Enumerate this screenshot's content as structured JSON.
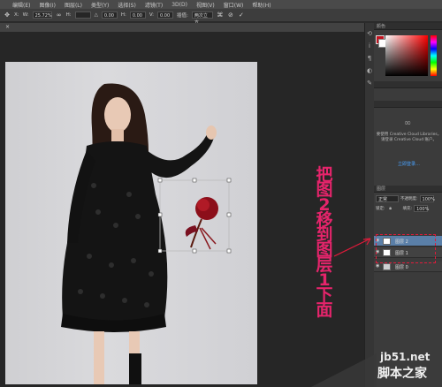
{
  "menubar": {
    "items": [
      "编辑(E)",
      "图像(I)",
      "图层(L)",
      "类型(Y)",
      "选择(S)",
      "滤镜(T)",
      "3D(D)",
      "视图(V)",
      "窗口(W)",
      "帮助(H)"
    ]
  },
  "options": {
    "x_label": "X:",
    "w_label": "W:",
    "w_value": "25.72%",
    "h_label": "H:",
    "angle_label": "△",
    "angle_value": "0.00",
    "h_skew_label": "H:",
    "h_skew_value": "0.00",
    "v_label": "V:",
    "v_value": "0.00",
    "interp_label": "插值:",
    "interp_value": "两次立方"
  },
  "color_panel": {
    "header": "颜色",
    "fg": "#c1121f",
    "bg": "#ffffff"
  },
  "cc": {
    "text": "要使用 Creative Cloud Libraries，请登录 Creative Cloud 账户。",
    "link": "立即登录…"
  },
  "layers_panel": {
    "header": "图层",
    "kind_label": "正常",
    "opacity_label": "不透明度:",
    "opacity_value": "100%",
    "lock_label": "锁定:",
    "fill_label": "填充:",
    "fill_value": "100%",
    "layers": [
      {
        "name": "图层 2",
        "selected": true
      },
      {
        "name": "图层 1",
        "selected": false
      },
      {
        "name": "图层 0",
        "selected": false
      }
    ]
  },
  "annotation": {
    "text": "把图2移到图层1下面",
    "color": "#e5246b",
    "lines": [
      "把",
      "图",
      "2",
      "移",
      "到",
      "图",
      "层",
      "1",
      "下",
      "面"
    ]
  },
  "watermark": {
    "line1": "jb51.net",
    "line2": "脚本之家"
  }
}
